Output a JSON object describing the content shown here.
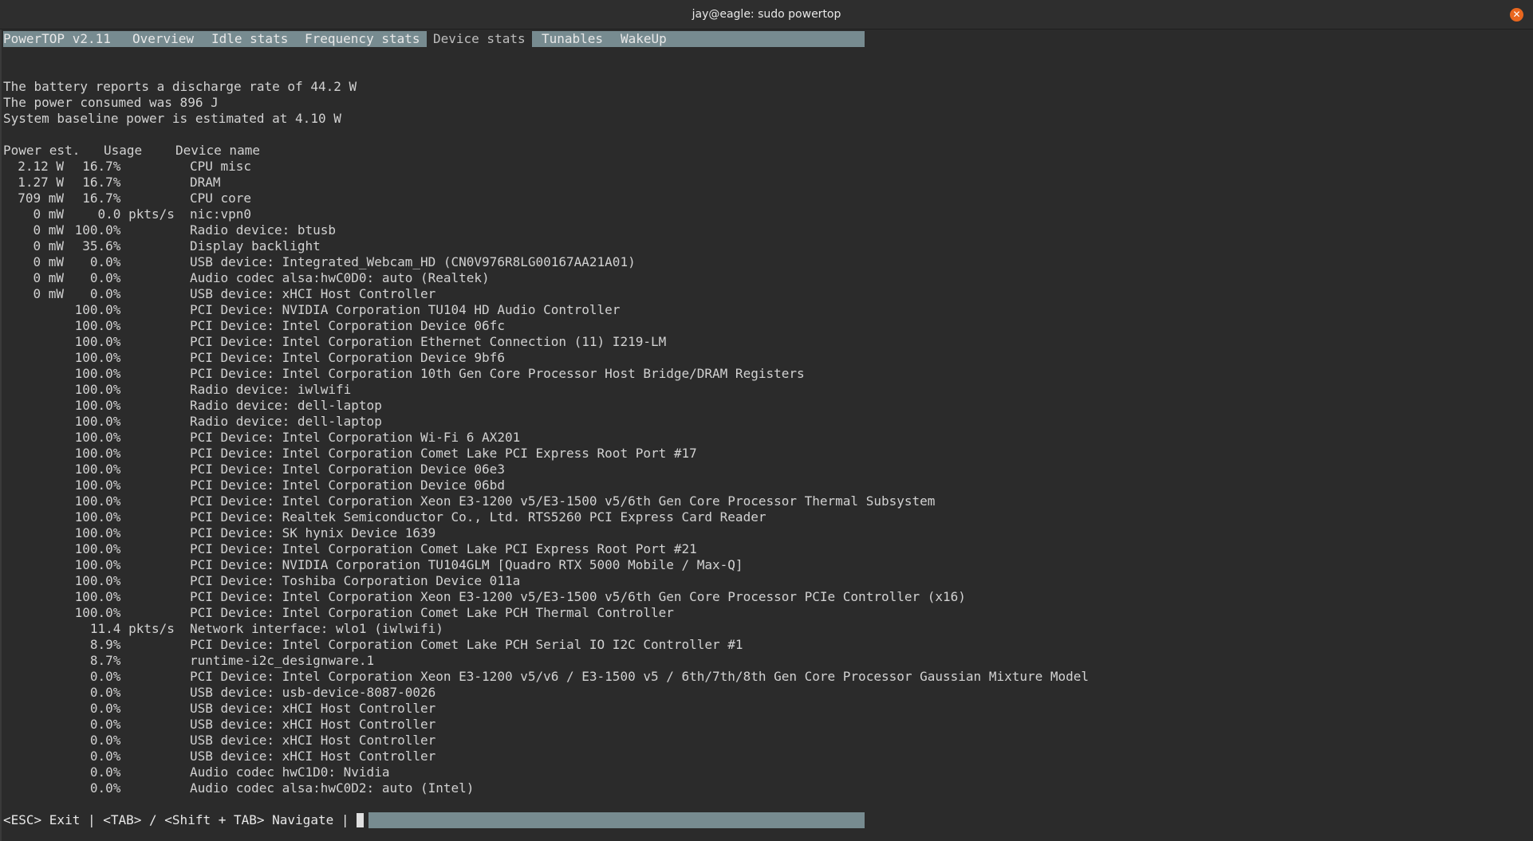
{
  "window": {
    "title": "jay@eagle: sudo powertop",
    "close_glyph": "✕"
  },
  "tabs": [
    {
      "label": "PowerTOP v2.11",
      "active": false
    },
    {
      "label": "Overview",
      "active": false
    },
    {
      "label": "Idle stats",
      "active": false
    },
    {
      "label": "Frequency stats",
      "active": false
    },
    {
      "label": "Device stats",
      "active": true
    },
    {
      "label": "Tunables",
      "active": false
    },
    {
      "label": "WakeUp",
      "active": false
    }
  ],
  "summary": {
    "discharge": "The battery reports a discharge rate of 44.2 W",
    "consumed": "The power consumed was 896 J",
    "baseline": "System baseline power is estimated at 4.10 W"
  },
  "table": {
    "headers": {
      "power": "Power est.",
      "usage": "Usage",
      "device": "Device name"
    },
    "rows": [
      {
        "power": "2.12 W",
        "usage": "16.7%",
        "device": "CPU misc"
      },
      {
        "power": "1.27 W",
        "usage": "16.7%",
        "device": "DRAM"
      },
      {
        "power": "709 mW",
        "usage": "16.7%",
        "device": "CPU core"
      },
      {
        "power": "0 mW",
        "usage": "0.0 pkts/s",
        "device": "nic:vpn0"
      },
      {
        "power": "0 mW",
        "usage": "100.0%",
        "device": "Radio device: btusb"
      },
      {
        "power": "0 mW",
        "usage": "35.6%",
        "device": "Display backlight"
      },
      {
        "power": "0 mW",
        "usage": "0.0%",
        "device": "USB device: Integrated_Webcam_HD (CN0V976R8LG00167AA21A01)"
      },
      {
        "power": "0 mW",
        "usage": "0.0%",
        "device": "Audio codec alsa:hwC0D0: auto (Realtek)"
      },
      {
        "power": "0 mW",
        "usage": "0.0%",
        "device": "USB device: xHCI Host Controller"
      },
      {
        "power": "",
        "usage": "100.0%",
        "device": "PCI Device: NVIDIA Corporation TU104 HD Audio Controller"
      },
      {
        "power": "",
        "usage": "100.0%",
        "device": "PCI Device: Intel Corporation Device 06fc"
      },
      {
        "power": "",
        "usage": "100.0%",
        "device": "PCI Device: Intel Corporation Ethernet Connection (11) I219-LM"
      },
      {
        "power": "",
        "usage": "100.0%",
        "device": "PCI Device: Intel Corporation Device 9bf6"
      },
      {
        "power": "",
        "usage": "100.0%",
        "device": "PCI Device: Intel Corporation 10th Gen Core Processor Host Bridge/DRAM Registers"
      },
      {
        "power": "",
        "usage": "100.0%",
        "device": "Radio device: iwlwifi"
      },
      {
        "power": "",
        "usage": "100.0%",
        "device": "Radio device: dell-laptop"
      },
      {
        "power": "",
        "usage": "100.0%",
        "device": "Radio device: dell-laptop"
      },
      {
        "power": "",
        "usage": "100.0%",
        "device": "PCI Device: Intel Corporation Wi-Fi 6 AX201"
      },
      {
        "power": "",
        "usage": "100.0%",
        "device": "PCI Device: Intel Corporation Comet Lake PCI Express Root Port #17"
      },
      {
        "power": "",
        "usage": "100.0%",
        "device": "PCI Device: Intel Corporation Device 06e3"
      },
      {
        "power": "",
        "usage": "100.0%",
        "device": "PCI Device: Intel Corporation Device 06bd"
      },
      {
        "power": "",
        "usage": "100.0%",
        "device": "PCI Device: Intel Corporation Xeon E3-1200 v5/E3-1500 v5/6th Gen Core Processor Thermal Subsystem"
      },
      {
        "power": "",
        "usage": "100.0%",
        "device": "PCI Device: Realtek Semiconductor Co., Ltd. RTS5260 PCI Express Card Reader"
      },
      {
        "power": "",
        "usage": "100.0%",
        "device": "PCI Device: SK hynix Device 1639"
      },
      {
        "power": "",
        "usage": "100.0%",
        "device": "PCI Device: Intel Corporation Comet Lake PCI Express Root Port #21"
      },
      {
        "power": "",
        "usage": "100.0%",
        "device": "PCI Device: NVIDIA Corporation TU104GLM [Quadro RTX 5000 Mobile / Max-Q]"
      },
      {
        "power": "",
        "usage": "100.0%",
        "device": "PCI Device: Toshiba Corporation Device 011a"
      },
      {
        "power": "",
        "usage": "100.0%",
        "device": "PCI Device: Intel Corporation Xeon E3-1200 v5/E3-1500 v5/6th Gen Core Processor PCIe Controller (x16)"
      },
      {
        "power": "",
        "usage": "100.0%",
        "device": "PCI Device: Intel Corporation Comet Lake PCH Thermal Controller"
      },
      {
        "power": "",
        "usage": "11.4 pkts/s",
        "device": "Network interface: wlo1 (iwlwifi)"
      },
      {
        "power": "",
        "usage": "8.9%",
        "device": "PCI Device: Intel Corporation Comet Lake PCH Serial IO I2C Controller #1"
      },
      {
        "power": "",
        "usage": "8.7%",
        "device": "runtime-i2c_designware.1"
      },
      {
        "power": "",
        "usage": "0.0%",
        "device": "PCI Device: Intel Corporation Xeon E3-1200 v5/v6 / E3-1500 v5 / 6th/7th/8th Gen Core Processor Gaussian Mixture Model"
      },
      {
        "power": "",
        "usage": "0.0%",
        "device": "USB device: usb-device-8087-0026"
      },
      {
        "power": "",
        "usage": "0.0%",
        "device": "USB device: xHCI Host Controller"
      },
      {
        "power": "",
        "usage": "0.0%",
        "device": "USB device: xHCI Host Controller"
      },
      {
        "power": "",
        "usage": "0.0%",
        "device": "USB device: xHCI Host Controller"
      },
      {
        "power": "",
        "usage": "0.0%",
        "device": "USB device: xHCI Host Controller"
      },
      {
        "power": "",
        "usage": "0.0%",
        "device": "Audio codec hwC1D0: Nvidia"
      },
      {
        "power": "",
        "usage": "0.0%",
        "device": "Audio codec alsa:hwC0D2: auto (Intel)"
      }
    ]
  },
  "statusbar": {
    "text": "<ESC> Exit | <TAB> / <Shift + TAB> Navigate |"
  },
  "colors": {
    "background": "#2b2b2b",
    "bar": "#778b90",
    "text": "#d2d2d2",
    "close_button": "#e9671f"
  }
}
